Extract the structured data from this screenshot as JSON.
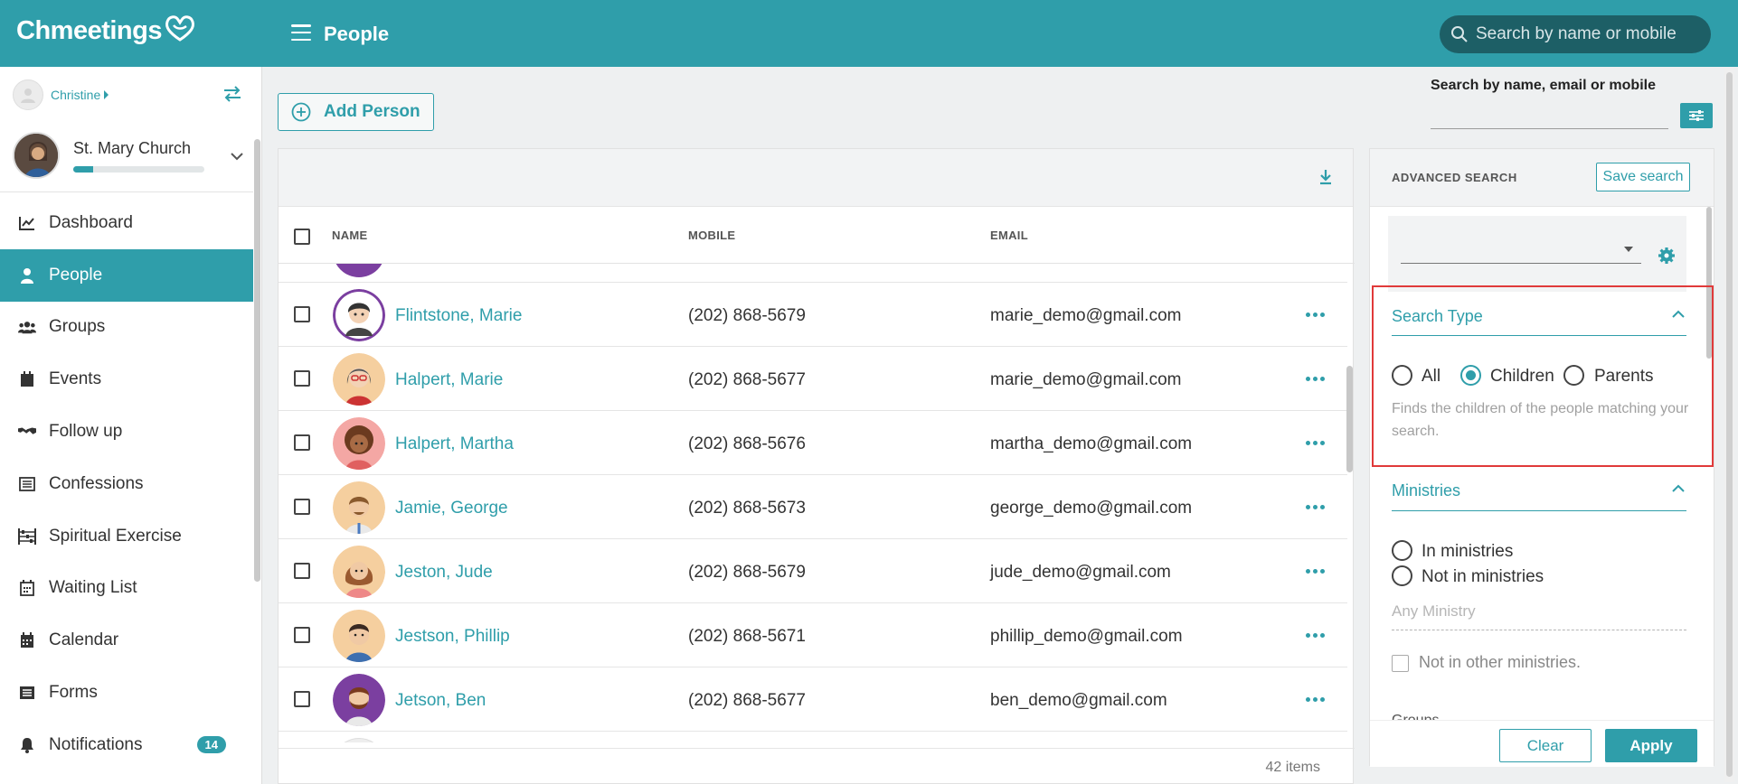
{
  "app": {
    "logo": "Chmeetings",
    "page_title": "People",
    "top_search_placeholder": "Search by name or mobile"
  },
  "sidebar": {
    "user_name": "Christine",
    "church_name": "St. Mary Church",
    "church_progress": 0.15,
    "items": [
      {
        "label": "Dashboard",
        "icon": "chart-icon"
      },
      {
        "label": "People",
        "icon": "person-icon",
        "active": true
      },
      {
        "label": "Groups",
        "icon": "groups-icon"
      },
      {
        "label": "Events",
        "icon": "calendar-icon"
      },
      {
        "label": "Follow up",
        "icon": "handshake-icon"
      },
      {
        "label": "Confessions",
        "icon": "list-icon"
      },
      {
        "label": "Spiritual Exercise",
        "icon": "abacus-icon"
      },
      {
        "label": "Waiting List",
        "icon": "calendar-grid-icon"
      },
      {
        "label": "Calendar",
        "icon": "calendar-icon"
      },
      {
        "label": "Forms",
        "icon": "form-icon"
      },
      {
        "label": "Notifications",
        "icon": "bell-icon",
        "badge": "14"
      }
    ]
  },
  "toolbar": {
    "add_person": "Add Person",
    "search_label": "Search by name, email or mobile"
  },
  "table": {
    "columns": {
      "name": "NAME",
      "mobile": "MOBILE",
      "email": "EMAIL"
    },
    "rows": [
      {
        "name": "Flintstone, Marie",
        "mobile": "(202) 868-5679",
        "email": "marie_demo@gmail.com",
        "avatar_bg": "#7b3fa0"
      },
      {
        "name": "Halpert, Marie",
        "mobile": "(202) 868-5677",
        "email": "marie_demo@gmail.com",
        "avatar_bg": "#f5cf9f"
      },
      {
        "name": "Halpert, Martha",
        "mobile": "(202) 868-5676",
        "email": "martha_demo@gmail.com",
        "avatar_bg": "#f4a7a4"
      },
      {
        "name": "Jamie, George",
        "mobile": "(202) 868-5673",
        "email": "george_demo@gmail.com",
        "avatar_bg": "#f5cf9f"
      },
      {
        "name": "Jeston, Jude",
        "mobile": "(202) 868-5679",
        "email": "jude_demo@gmail.com",
        "avatar_bg": "#f5cf9f"
      },
      {
        "name": "Jestson, Phillip",
        "mobile": "(202) 868-5671",
        "email": "phillip_demo@gmail.com",
        "avatar_bg": "#f5cf9f"
      },
      {
        "name": "Jetson, Ben",
        "mobile": "(202) 868-5677",
        "email": "ben_demo@gmail.com",
        "avatar_bg": "#7b3fa0"
      }
    ],
    "items_count": "42 items"
  },
  "advanced": {
    "title": "ADVANCED SEARCH",
    "save_search": "Save search",
    "search_type": {
      "title": "Search Type",
      "options": [
        "All",
        "Children",
        "Parents"
      ],
      "selected": "Children",
      "hint": "Finds the children of the people matching your search."
    },
    "ministries": {
      "title": "Ministries",
      "opt_in": "In ministries",
      "opt_not_in": "Not in ministries",
      "placeholder": "Any Ministry",
      "not_other": "Not in other ministries."
    },
    "groups_title": "Groups",
    "clear": "Clear",
    "apply": "Apply"
  },
  "colors": {
    "accent": "#2f9eaa",
    "highlight": "#e03a3a"
  }
}
